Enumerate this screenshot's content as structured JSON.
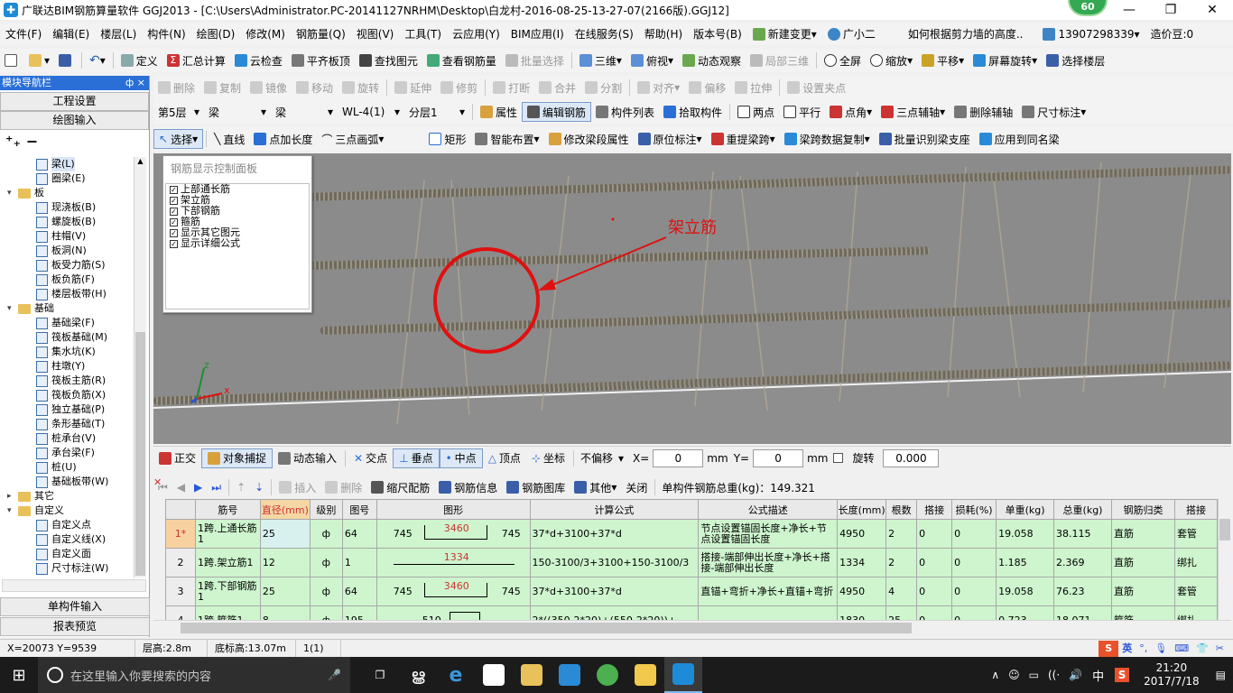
{
  "window": {
    "title": "广联达BIM钢筋算量软件 GGJ2013 - [C:\\Users\\Administrator.PC-20141127NRHM\\Desktop\\白龙村-2016-08-25-13-27-07(2166版).GGJ12]",
    "badge": "60"
  },
  "menu": [
    "文件(F)",
    "编辑(E)",
    "楼层(L)",
    "构件(N)",
    "绘图(D)",
    "修改(M)",
    "钢筋量(Q)",
    "视图(V)",
    "工具(T)",
    "云应用(Y)",
    "BIM应用(I)",
    "在线服务(S)",
    "帮助(H)",
    "版本号(B)",
    "新建变更",
    "广小二"
  ],
  "menu_right": {
    "question": "如何根据剪力墙的高度..",
    "phone": "13907298339",
    "coins": "造价豆:0"
  },
  "toolbar1": [
    "定义",
    "汇总计算",
    "云检查",
    "平齐板顶",
    "查找图元",
    "查看钢筋量",
    "批量选择",
    "三维",
    "俯视",
    "动态观察",
    "局部三维",
    "全屏",
    "缩放",
    "平移",
    "屏幕旋转",
    "选择楼层"
  ],
  "toolbar2": [
    "删除",
    "复制",
    "镜像",
    "移动",
    "旋转",
    "延伸",
    "修剪",
    "打断",
    "合并",
    "分割",
    "对齐",
    "偏移",
    "拉伸",
    "设置夹点"
  ],
  "toolbar3": {
    "floor": "第5层",
    "category": "梁",
    "type": "梁",
    "element": "WL-4(1)",
    "layer": "分层1",
    "buttons": [
      "属性",
      "编辑钢筋",
      "构件列表",
      "拾取构件",
      "两点",
      "平行",
      "点角",
      "三点辅轴",
      "删除辅轴",
      "尺寸标注"
    ]
  },
  "toolbar4": [
    "选择",
    "直线",
    "点加长度",
    "三点画弧",
    "矩形",
    "智能布置",
    "修改梁段属性",
    "原位标注",
    "重提梁跨",
    "梁跨数据复制",
    "批量识别梁支座",
    "应用到同名梁"
  ],
  "nav": {
    "header": "模块导航栏",
    "pin": "ф ×",
    "section1": "工程设置",
    "section2": "绘图输入",
    "bottom1": "单构件输入",
    "bottom2": "报表预览",
    "tree": [
      {
        "label": "梁(L)",
        "level": 2,
        "selected": true
      },
      {
        "label": "圈梁(E)",
        "level": 2
      },
      {
        "label": "板",
        "level": 1,
        "folder": true
      },
      {
        "label": "现浇板(B)",
        "level": 2
      },
      {
        "label": "螺旋板(B)",
        "level": 2
      },
      {
        "label": "柱帽(V)",
        "level": 2
      },
      {
        "label": "板洞(N)",
        "level": 2
      },
      {
        "label": "板受力筋(S)",
        "level": 2
      },
      {
        "label": "板负筋(F)",
        "level": 2
      },
      {
        "label": "楼层板带(H)",
        "level": 2
      },
      {
        "label": "基础",
        "level": 1,
        "folder": true
      },
      {
        "label": "基础梁(F)",
        "level": 2
      },
      {
        "label": "筏板基础(M)",
        "level": 2
      },
      {
        "label": "集水坑(K)",
        "level": 2
      },
      {
        "label": "柱墩(Y)",
        "level": 2
      },
      {
        "label": "筏板主筋(R)",
        "level": 2
      },
      {
        "label": "筏板负筋(X)",
        "level": 2
      },
      {
        "label": "独立基础(P)",
        "level": 2
      },
      {
        "label": "条形基础(T)",
        "level": 2
      },
      {
        "label": "桩承台(V)",
        "level": 2
      },
      {
        "label": "承台梁(F)",
        "level": 2
      },
      {
        "label": "桩(U)",
        "level": 2
      },
      {
        "label": "基础板带(W)",
        "level": 2
      },
      {
        "label": "其它",
        "level": 1,
        "folder": true,
        "collapsed": true
      },
      {
        "label": "自定义",
        "level": 1,
        "folder": true
      },
      {
        "label": "自定义点",
        "level": 2
      },
      {
        "label": "自定义线(X)",
        "level": 2
      },
      {
        "label": "自定义面",
        "level": 2
      },
      {
        "label": "尺寸标注(W)",
        "level": 2
      }
    ]
  },
  "control_panel": {
    "title": "钢筋显示控制面板",
    "items": [
      "上部通长筋",
      "架立筋",
      "下部钢筋",
      "箍筋",
      "显示其它图元",
      "显示详细公式"
    ]
  },
  "annotation": {
    "label": "架立筋"
  },
  "snap": {
    "buttons": [
      "正交",
      "对象捕捉",
      "动态输入",
      "交点",
      "垂点",
      "中点",
      "顶点",
      "坐标"
    ],
    "offset": "不偏移",
    "x_label": "X=",
    "x": "0",
    "y_label": "Y=",
    "y": "0",
    "unit": "mm",
    "rotate_label": "旋转",
    "rotate": "0.000"
  },
  "grid_toolbar": {
    "buttons": [
      "插入",
      "删除",
      "缩尺配筋",
      "钢筋信息",
      "钢筋图库",
      "其他",
      "关闭"
    ],
    "total": "单构件钢筋总重(kg)：149.321"
  },
  "grid": {
    "columns": [
      "筋号",
      "直径(mm)",
      "级别",
      "图号",
      "图形",
      "计算公式",
      "公式描述",
      "长度(mm)",
      "根数",
      "搭接",
      "损耗(%)",
      "单重(kg)",
      "总重(kg)",
      "钢筋归类",
      "搭接"
    ],
    "rows": [
      {
        "no": "1*",
        "name": "1跨.上通长筋1",
        "dia": "25",
        "grade": "ф",
        "fig": "64",
        "shape_left": "745",
        "shape_mid": "3460",
        "shape_right": "745",
        "formula": "37*d+3100+37*d",
        "desc": "节点设置锚固长度+净长+节点设置锚固长度",
        "len": "4950",
        "count": "2",
        "lap": "0",
        "loss": "0",
        "unit_w": "19.058",
        "total_w": "38.115",
        "cat": "直筋",
        "lap_type": "套管"
      },
      {
        "no": "2",
        "name": "1跨.架立筋1",
        "dia": "12",
        "grade": "ф",
        "fig": "1",
        "shape_left": "",
        "shape_mid": "1334",
        "shape_right": "",
        "formula": "150-3100/3+3100+150-3100/3",
        "desc": "搭接-端部伸出长度+净长+搭接-端部伸出长度",
        "len": "1334",
        "count": "2",
        "lap": "0",
        "loss": "0",
        "unit_w": "1.185",
        "total_w": "2.369",
        "cat": "直筋",
        "lap_type": "绑扎"
      },
      {
        "no": "3",
        "name": "1跨.下部钢筋1",
        "dia": "25",
        "grade": "ф",
        "fig": "64",
        "shape_left": "745",
        "shape_mid": "3460",
        "shape_right": "745",
        "formula": "37*d+3100+37*d",
        "desc": "直锚+弯折+净长+直锚+弯折",
        "len": "4950",
        "count": "4",
        "lap": "0",
        "loss": "0",
        "unit_w": "19.058",
        "total_w": "76.23",
        "cat": "直筋",
        "lap_type": "套管"
      },
      {
        "no": "4",
        "name": "1跨.箍筋1",
        "dia": "8",
        "grade": "ф",
        "fig": "195",
        "shape_left": "510",
        "shape_mid": "",
        "shape_right": "",
        "formula": "2*((350-2*20)+(550-2*20))+",
        "desc": "",
        "len": "1830",
        "count": "25",
        "lap": "0",
        "loss": "0",
        "unit_w": "0.723",
        "total_w": "18.071",
        "cat": "箍筋",
        "lap_type": "绑扎"
      }
    ]
  },
  "status": [
    "X=20073 Y=9539",
    "层高:2.8m",
    "底标高:13.07m",
    "1(1)"
  ],
  "taskbar": {
    "search": "在这里输入你要搜索的内容",
    "time": "21:20",
    "date": "2017/7/18",
    "ime": "中",
    "ime2": "英"
  },
  "colors": {
    "accent": "#2a6fd6",
    "grid_green": "#cef5ce",
    "annotation_red": "#e01010"
  }
}
